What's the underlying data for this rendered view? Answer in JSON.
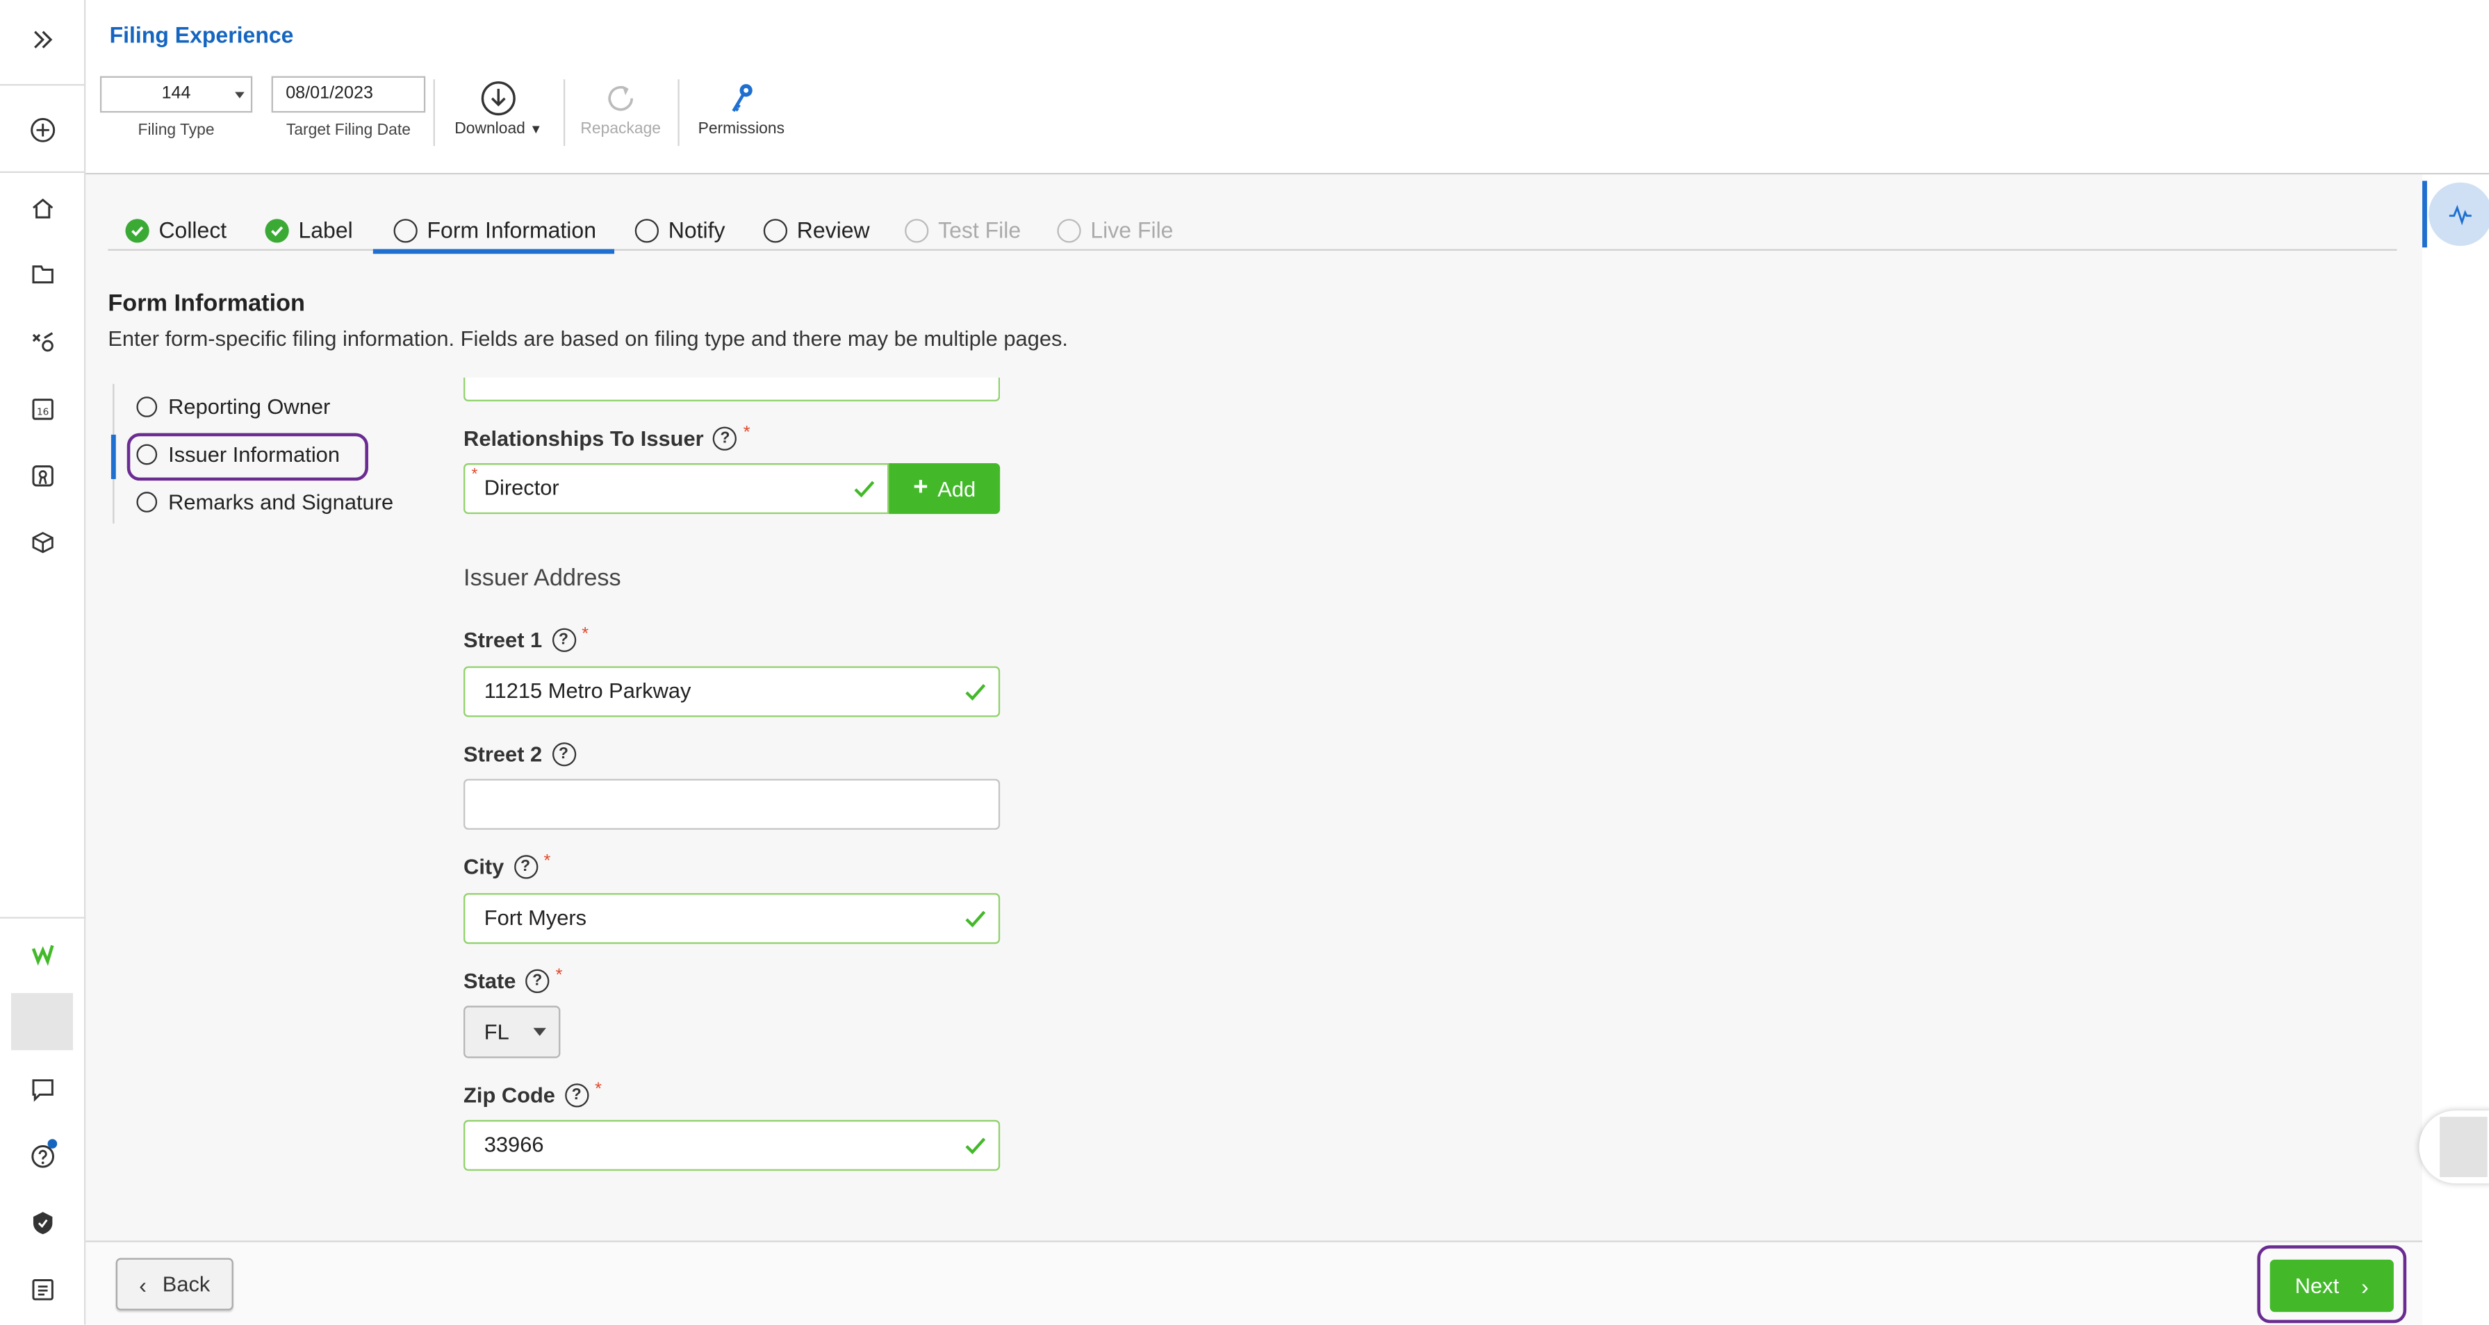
{
  "header": {
    "app_title": "Filing Experience",
    "filing_type_value": "144",
    "filing_type_label": "Filing Type",
    "target_date_value": "08/01/2023",
    "target_date_label": "Target Filing Date",
    "download_label": "Download",
    "repackage_label": "Repackage",
    "permissions_label": "Permissions"
  },
  "tabs": [
    {
      "label": "Collect",
      "state": "complete"
    },
    {
      "label": "Label",
      "state": "complete"
    },
    {
      "label": "Form Information",
      "state": "active"
    },
    {
      "label": "Notify",
      "state": "pending"
    },
    {
      "label": "Review",
      "state": "pending"
    },
    {
      "label": "Test File",
      "state": "disabled"
    },
    {
      "label": "Live File",
      "state": "disabled"
    }
  ],
  "section": {
    "title": "Form Information",
    "description": "Enter form-specific filing information. Fields are based on filing type and there may be multiple pages."
  },
  "subnav": [
    {
      "label": "Reporting Owner"
    },
    {
      "label": "Issuer Information"
    },
    {
      "label": "Remarks and Signature"
    }
  ],
  "form": {
    "relationships_label": "Relationships To Issuer",
    "relationship_value": "Director",
    "add_label": "Add",
    "address_heading": "Issuer Address",
    "street1_label": "Street 1",
    "street1_value": "11215 Metro Parkway",
    "street2_label": "Street 2",
    "street2_value": "",
    "city_label": "City",
    "city_value": "Fort Myers",
    "state_label": "State",
    "state_value": "FL",
    "zip_label": "Zip Code",
    "zip_value": "33966",
    "required_mark": "*",
    "help_mark": "?"
  },
  "footer": {
    "back_label": "Back",
    "next_label": "Next"
  },
  "colors": {
    "accent_blue": "#1565c0",
    "success_green": "#43b92a",
    "highlight_purple": "#6a2c91",
    "required_red": "#e0482a"
  },
  "icons": {
    "rail": [
      "expand-icon",
      "add-circle-icon",
      "home-icon",
      "folder-icon",
      "tasks-icon",
      "calendar-icon",
      "certificate-icon",
      "cube-icon",
      "workiva-logo-icon",
      "chat-icon",
      "help-icon",
      "shield-icon",
      "notes-icon"
    ],
    "toolbar": [
      "download-icon",
      "repackage-icon",
      "permissions-key-icon"
    ],
    "right_rail": [
      "activity-pulse-icon"
    ]
  }
}
